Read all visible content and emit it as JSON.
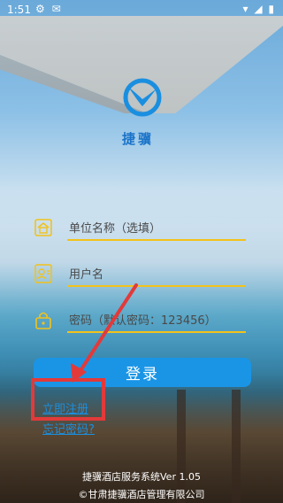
{
  "status": {
    "time": "1:51",
    "left_icons": [
      "gear-icon",
      "email-icon"
    ],
    "right_icons": [
      "wifi-icon",
      "signal-icon",
      "battery-icon"
    ]
  },
  "brand": {
    "name": "捷骥"
  },
  "fields": {
    "unit": {
      "placeholder": "单位名称（选填）",
      "icon": "building-icon"
    },
    "user": {
      "placeholder": "用户名",
      "icon": "id-card-icon"
    },
    "password": {
      "placeholder": "密码（默认密码：123456）",
      "icon": "lock-icon"
    }
  },
  "actions": {
    "login": "登录",
    "register": "立即注册",
    "forgot": "忘记密码?"
  },
  "annotation": {
    "color": "#e23a3a"
  },
  "footer": {
    "version": "捷骥酒店服务系统Ver 1.05",
    "copyright": "©甘肃捷骥酒店管理有限公司"
  },
  "colors": {
    "accent": "#1a95e6",
    "underline": "#f2c21a",
    "link": "#1a8fe0"
  }
}
